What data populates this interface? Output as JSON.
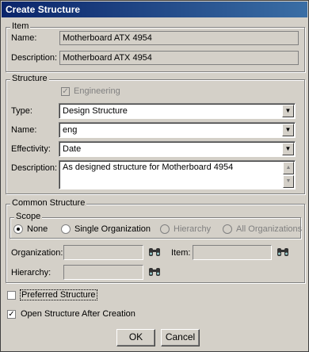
{
  "window": {
    "title": "Create Structure"
  },
  "item": {
    "group_label": "Item",
    "name_label": "Name:",
    "name_value": "Motherboard ATX 4954",
    "description_label": "Description:",
    "description_value": "Motherboard ATX 4954"
  },
  "structure": {
    "group_label": "Structure",
    "engineering_label": "Engineering",
    "type_label": "Type:",
    "type_value": "Design Structure",
    "name_label": "Name:",
    "name_value": "eng",
    "effectivity_label": "Effectivity:",
    "effectivity_value": "Date",
    "description_label": "Description:",
    "description_value": "As designed structure for Motherboard 4954"
  },
  "common": {
    "group_label": "Common Structure",
    "scope_label": "Scope",
    "scope_options": [
      "None",
      "Single Organization",
      "Hierarchy",
      "All Organizations"
    ],
    "organization_label": "Organization:",
    "item_label": "Item:",
    "hierarchy_label": "Hierarchy:"
  },
  "options": {
    "preferred_label": "Preferred Structure",
    "open_after_label": "Open Structure After Creation"
  },
  "buttons": {
    "ok": "OK",
    "cancel": "Cancel"
  }
}
